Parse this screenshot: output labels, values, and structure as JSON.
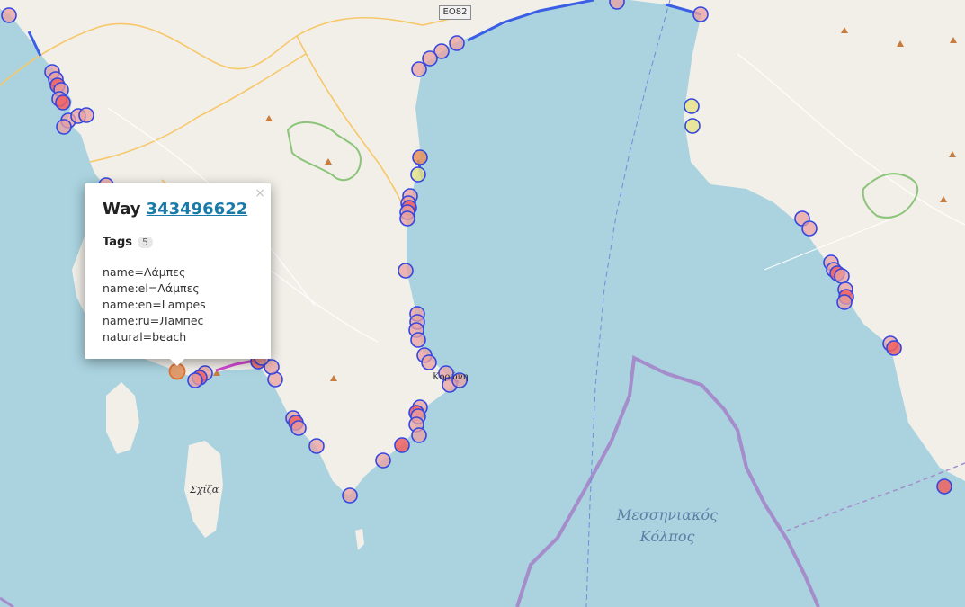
{
  "popup": {
    "type_label": "Way",
    "id_link": "343496622",
    "tags_heading": "Tags",
    "tags_count": "5",
    "tags": [
      "name=Λάμπες",
      "name:el=Λάμπες",
      "name:en=Lampes",
      "name:ru=Лампес",
      "natural=beach"
    ],
    "close_symbol": "×"
  },
  "map_labels": {
    "sea_line1": "Μεσσηνιακός",
    "sea_line2": "Κόλπος",
    "island": "Σχίζα",
    "town": "Κορώνη",
    "road_shield": "ΕΟ82"
  },
  "colors": {
    "sea": "#aad3df",
    "land": "#f2efe9",
    "marker_fill": "#e9a0a0",
    "marker_stroke": "#3346e0",
    "marker_fill_strong": "#f06060",
    "marker_fill_yellow": "#e8e48c",
    "marker_fill_orange": "#e8905a",
    "boundary": "#a58ccb",
    "link": "#1a7ba8"
  }
}
